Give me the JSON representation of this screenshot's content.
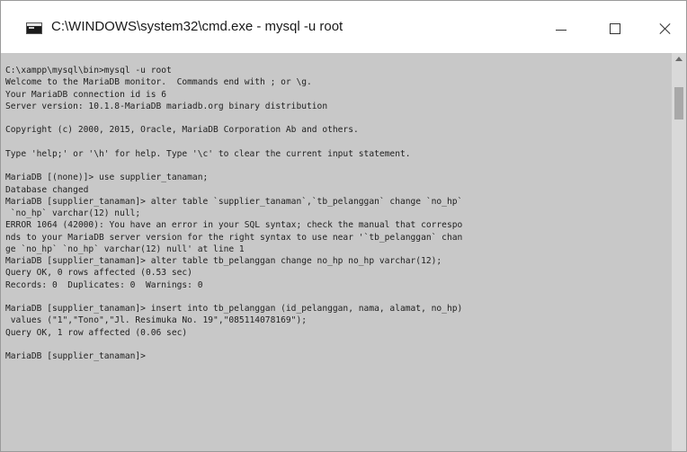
{
  "window": {
    "title": "C:\\WINDOWS\\system32\\cmd.exe - mysql  -u root",
    "icon": "cmd-icon"
  },
  "controls": {
    "minimize_icon": "minimize-icon",
    "maximize_icon": "maximize-icon",
    "close_icon": "close-icon"
  },
  "colors": {
    "console_background": "#c8c8c8",
    "console_text": "#1e1e1e"
  },
  "console": {
    "lines": [
      "C:\\xampp\\mysql\\bin>mysql -u root",
      "Welcome to the MariaDB monitor.  Commands end with ; or \\g.",
      "Your MariaDB connection id is 6",
      "Server version: 10.1.8-MariaDB mariadb.org binary distribution",
      "",
      "Copyright (c) 2000, 2015, Oracle, MariaDB Corporation Ab and others.",
      "",
      "Type 'help;' or '\\h' for help. Type '\\c' to clear the current input statement.",
      "",
      "MariaDB [(none)]> use supplier_tanaman;",
      "Database changed",
      "MariaDB [supplier_tanaman]> alter table `supplier_tanaman`,`tb_pelanggan` change `no_hp`",
      " `no_hp` varchar(12) null;",
      "ERROR 1064 (42000): You have an error in your SQL syntax; check the manual that correspo",
      "nds to your MariaDB server version for the right syntax to use near '`tb_pelanggan` chan",
      "ge `no_hp` `no_hp` varchar(12) null' at line 1",
      "MariaDB [supplier_tanaman]> alter table tb_pelanggan change no_hp no_hp varchar(12);",
      "Query OK, 0 rows affected (0.53 sec)",
      "Records: 0  Duplicates: 0  Warnings: 0",
      "",
      "MariaDB [supplier_tanaman]> insert into tb_pelanggan (id_pelanggan, nama, alamat, no_hp)",
      " values (\"1\",\"Tono\",\"Jl. Resimuka No. 19\",\"085114078169\");",
      "Query OK, 1 row affected (0.06 sec)",
      "",
      "MariaDB [supplier_tanaman]>"
    ]
  }
}
